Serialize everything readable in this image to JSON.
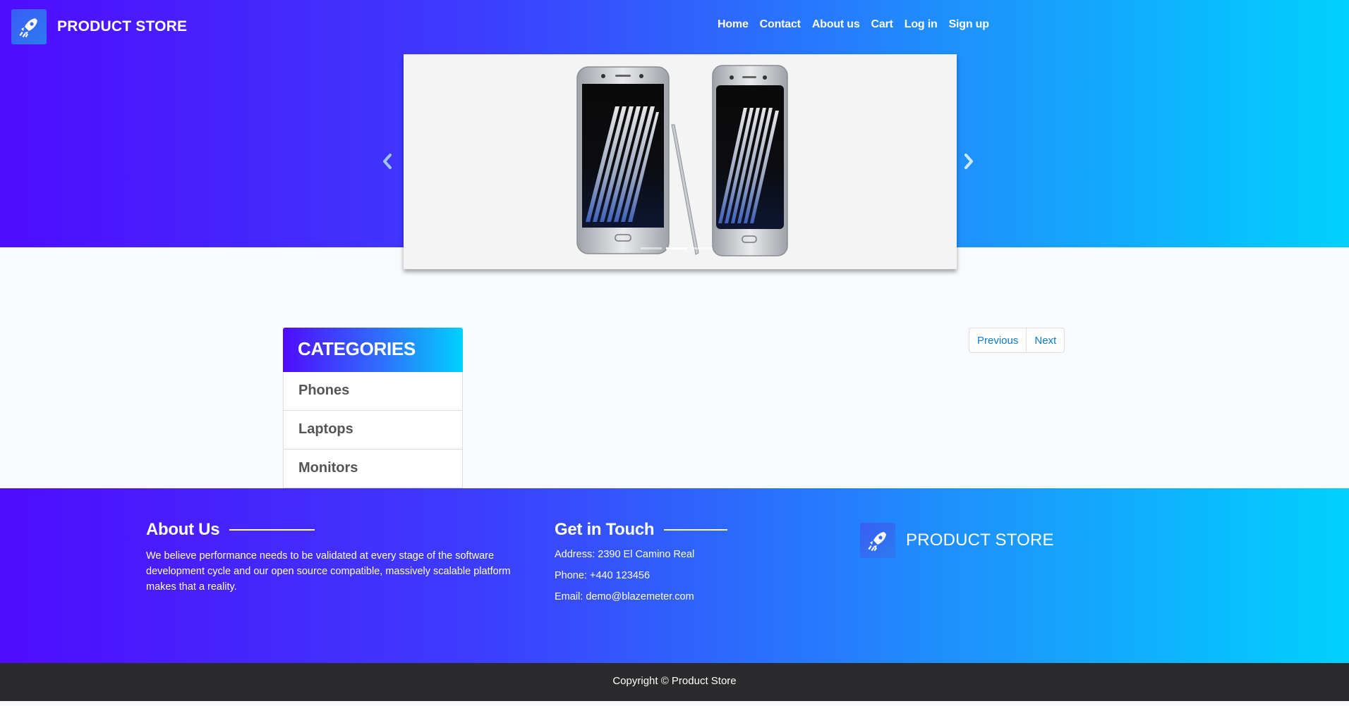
{
  "header": {
    "brand": "PRODUCT STORE",
    "logo_icon": "rocket-logo-icon",
    "nav": [
      "Home",
      "Contact",
      "About us",
      "Cart",
      "Log in",
      "Sign up"
    ]
  },
  "carousel": {
    "image": "samsung-galaxy-note-phones",
    "prev_icon": "chevron-left-icon",
    "next_icon": "chevron-right-icon",
    "slides": 3,
    "active_slide": 1
  },
  "categories": {
    "title": "CATEGORIES",
    "items": [
      "Phones",
      "Laptops",
      "Monitors"
    ]
  },
  "pagination": {
    "previous": "Previous",
    "next": "Next"
  },
  "footer": {
    "about_title": "About Us",
    "about_text": "We believe performance needs to be validated at every stage of the software development cycle and our open source compatible, massively scalable platform makes that a reality.",
    "contact_title": "Get in Touch",
    "address": "Address: 2390 El Camino Real",
    "phone": "Phone: +440 123456",
    "email": "Email: demo@blazemeter.com",
    "brand": "PRODUCT STORE",
    "copyright": "Copyright © Product Store"
  },
  "colors": {
    "gradient_start": "#4f0cfd",
    "gradient_end": "#00d1fd",
    "link": "#0b7ad1",
    "copyright_bg": "#2b2b2d"
  }
}
